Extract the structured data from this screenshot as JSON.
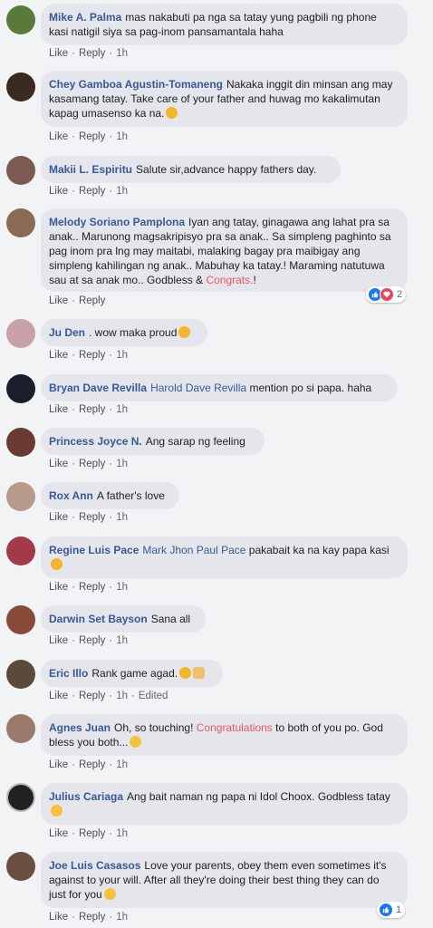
{
  "actions": {
    "like": "Like",
    "reply": "Reply",
    "sep": "·"
  },
  "comments": [
    {
      "author": "Mike A. Palma",
      "text": "mas nakabuti pa nga sa tatay yung pagbili ng phone kasi natigil siya sa pag-inom pansamantala haha",
      "time": "1h",
      "avatar_color": "#5a7a3a"
    },
    {
      "author": "Chey Gamboa Agustin-Tomaneng",
      "text": "Nakaka inggit din minsan ang may kasamang tatay. Take care of your father and huwag mo kakalimutan kapag umasenso ka na.",
      "emoji": "smiling-face-hearts",
      "time": "1h",
      "avatar_color": "#3a2a22"
    },
    {
      "author": "Makii L. Espiritu",
      "text": "Salute sir,advance happy fathers day.",
      "time": "1h",
      "avatar_color": "#7a5a52"
    },
    {
      "author": "Melody Soriano Pamplona",
      "text": "Iyan ang tatay, ginagawa ang lahat pra sa anak.. Marunong magsakripisyo pra sa anak.. Sa simpleng paghinto sa pag inom pra lng may maitabi, malaking bagay pra maibigay ang simpleng kahilingan ng anak.. Mabuhay ka tatay.! Maraming natutuwa sau at sa anak mo.. Godbless & ",
      "highlight": "Congrats.",
      "tail": "!",
      "time": "",
      "reaction_count": "2",
      "avatar_color": "#8a6a55"
    },
    {
      "author": "Ju Den",
      "text": ". wow maka proud",
      "emoji": "smiling-face-hearts",
      "time": "1h",
      "avatar_color": "#c9a0a8"
    },
    {
      "author": "Bryan Dave Revilla",
      "mention": "Harold Dave Revilla",
      "text": "mention po si papa. haha",
      "time": "1h",
      "avatar_color": "#1a1e2a"
    },
    {
      "author": "Princess Joyce N.",
      "text": "Ang sarap ng feeling",
      "time": "1h",
      "avatar_color": "#6a3a30"
    },
    {
      "author": "Rox Ann",
      "text": "A father's love",
      "time": "1h",
      "avatar_color": "#b89a8a"
    },
    {
      "author": "Regine Luis Pace",
      "mention": "Mark Jhon Paul Pace",
      "text": "pakabait ka na kay papa kasi",
      "emoji": "rofl",
      "time": "1h",
      "avatar_color": "#a33a4a"
    },
    {
      "author": "Darwin Set Bayson",
      "text": "Sana all",
      "time": "1h",
      "avatar_color": "#8a4a3a"
    },
    {
      "author": "Eric Illo",
      "text": "Rank game agad.",
      "emoji": "joy-victory",
      "time": "1h",
      "edited": "Edited",
      "avatar_color": "#5a4a3a"
    },
    {
      "author": "Agnes Juan",
      "text": "Oh, so touching! ",
      "highlight": "Congratulations",
      "tail": " to both of you po. God bless you both...",
      "emoji": "smile",
      "time": "1h",
      "avatar_color": "#9a7a6a"
    },
    {
      "author": "Julius Cariaga",
      "text": "Ang bait naman ng papa ni Idol Choox. Godbless tatay",
      "emoji": "smile",
      "time": "1h",
      "avatar_color": "#222222"
    },
    {
      "author": "Joe Luis Casasos",
      "text": "Love your parents, obey them even sometimes it's against to your will. After all they're doing their best thing they can do just for you",
      "emoji": "smile",
      "time": "1h",
      "reaction_count": "1",
      "avatar_color": "#6a5040"
    }
  ]
}
